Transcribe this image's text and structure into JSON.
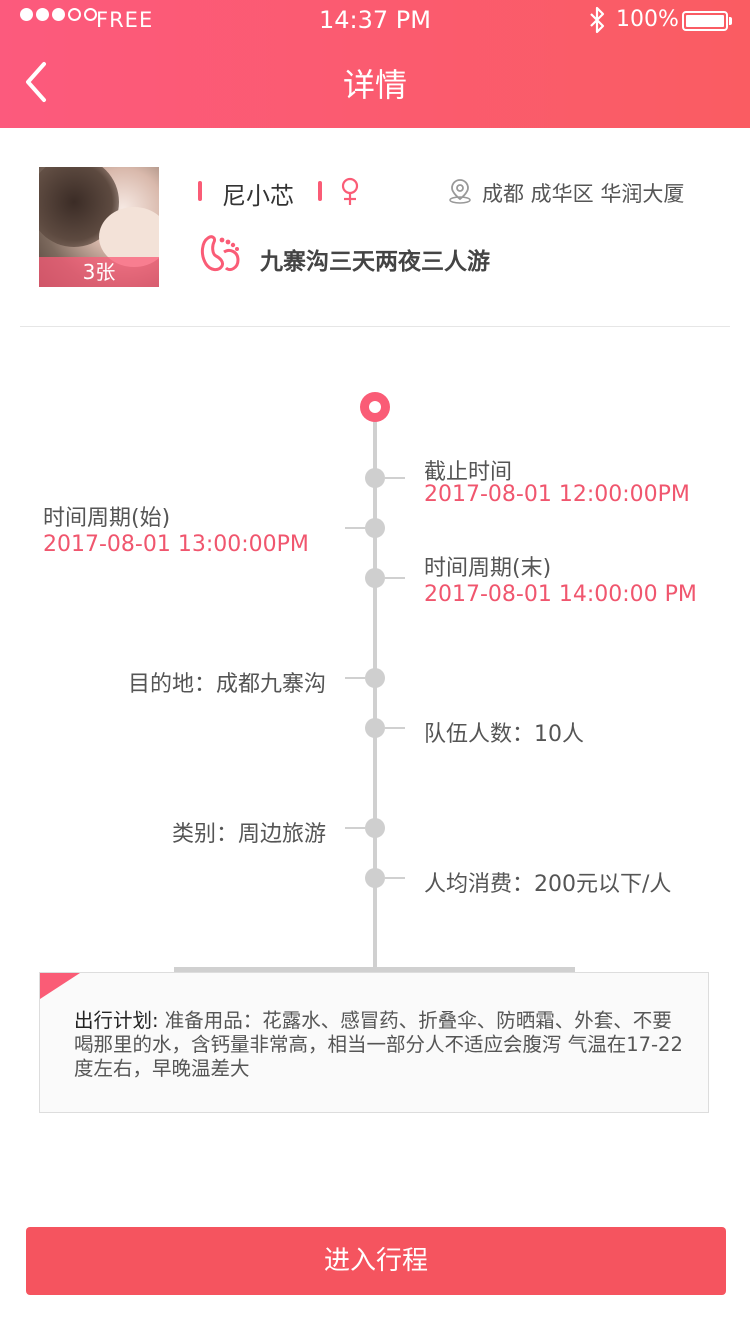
{
  "status_bar": {
    "carrier": "FREE",
    "time": "14:37 PM",
    "battery": "100%"
  },
  "header": {
    "title": "详情",
    "back_icon": "chevron-left-icon"
  },
  "profile": {
    "photo_count": "3张",
    "name": "尼小芯",
    "gender_icon": "female-icon",
    "location": "成都 成华区 华润大厦",
    "trip_title": "九寨沟三天两夜三人游"
  },
  "timeline": {
    "deadline": {
      "label": "截止时间",
      "value": "2017-08-01 12:00:00PM"
    },
    "period_start": {
      "label": "时间周期(始)",
      "value": "2017-08-01 13:00:00PM"
    },
    "period_end": {
      "label": "时间周期(末)",
      "value": "2017-08-01 14:00:00 PM"
    },
    "destination": "目的地：成都九寨沟",
    "team_size": "队伍人数：10人",
    "category": "类别：周边旅游",
    "cost": "人均消费：200元以下/人"
  },
  "plan": {
    "key": "出行计划:",
    "text": " 准备用品：花露水、感冒药、折叠伞、防晒霜、外套、不要喝那里的水，含钙量非常高，相当一部分人不适应会腹泻 气温在17-22度左右，早晚温差大"
  },
  "cta": {
    "label": "进入行程"
  },
  "colors": {
    "accent": "#fa5c76",
    "header_start": "#fc5a7d",
    "header_end": "#fa5c62",
    "cta": "#f5545f",
    "date": "#f0566e"
  }
}
